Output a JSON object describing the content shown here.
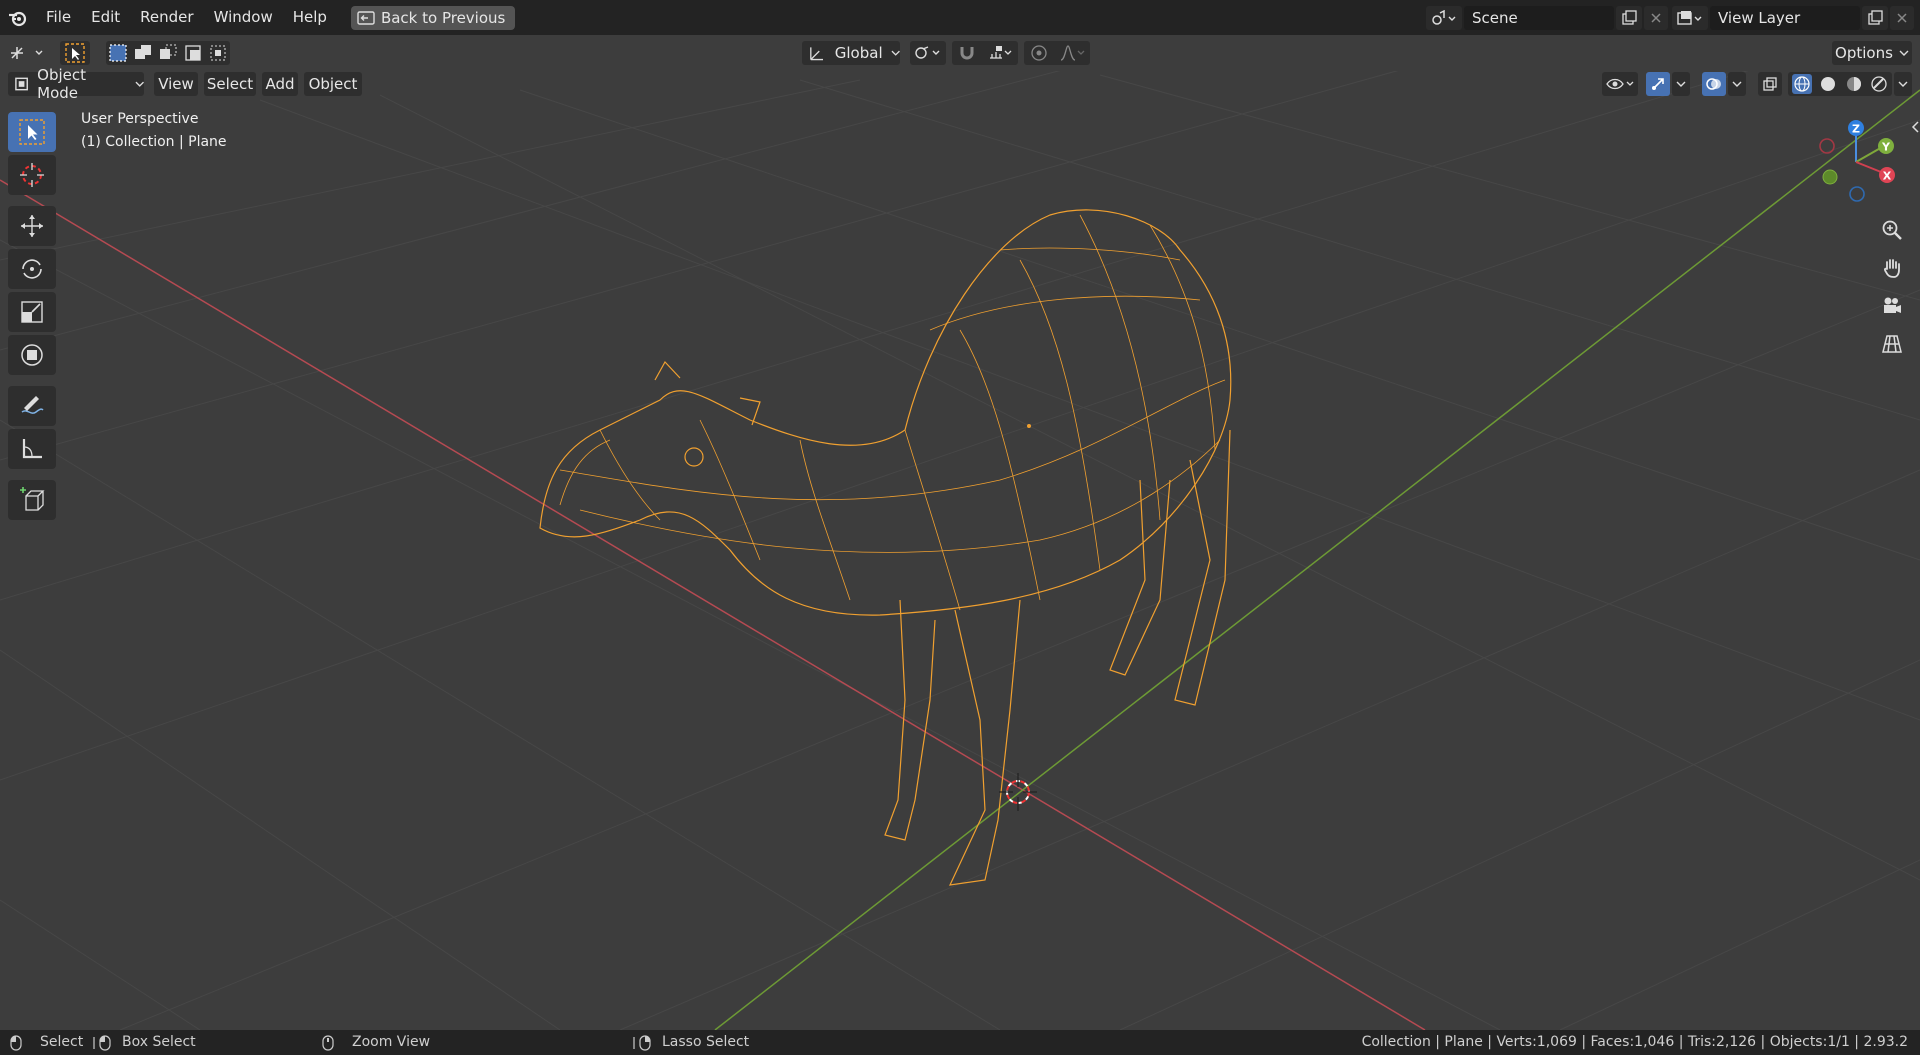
{
  "topbar": {
    "menus": [
      "File",
      "Edit",
      "Render",
      "Window",
      "Help"
    ],
    "back_label": "Back to Previous",
    "scene_value": "Scene",
    "view_layer_value": "View Layer"
  },
  "header": {
    "transform_orientation": "Global",
    "options_label": "Options"
  },
  "viewport_header": {
    "mode": "Object Mode",
    "menus": [
      "View",
      "Select",
      "Add",
      "Object"
    ]
  },
  "overlay": {
    "perspective": "User Perspective",
    "collection": "(1) Collection | Plane"
  },
  "gizmo": {
    "z": "Z",
    "y": "Y",
    "x": "X"
  },
  "status": {
    "select": "Select",
    "box_select": "Box Select",
    "zoom_view": "Zoom View",
    "lasso_select": "Lasso Select",
    "stats": "Collection | Plane | Verts:1,069 | Faces:1,046 | Tris:2,126 | Objects:1/1 | 2.93.2"
  },
  "colors": {
    "accent": "#4772b3",
    "wire": "#f0a030",
    "x_axis": "#c0414b",
    "y_axis": "#7aa83a"
  }
}
